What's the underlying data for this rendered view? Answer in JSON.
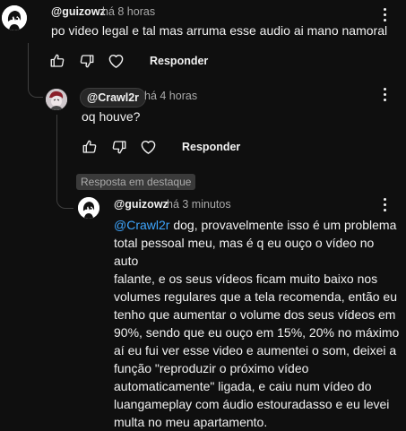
{
  "comments": [
    {
      "author": "@guizowz",
      "time": "há 8 horas",
      "text": "po video legal e tal mas arruma esse audio ai mano namoral",
      "reply_label": "Responder"
    },
    {
      "author": "@Crawl2r",
      "time": "há 4 horas",
      "text": "oq houve?",
      "reply_label": "Responder"
    },
    {
      "badge": "Resposta em destaque",
      "author": "@guizowz",
      "time": "há 3 minutos",
      "mention": "@Crawl2r",
      "lines": [
        " dog, provavelmente isso é um problema",
        "total pessoal meu, mas é q eu ouço o vídeo no auto",
        "falante, e os seus vídeos ficam muito baixo nos",
        "volumes regulares que a tela recomenda, então eu",
        "tenho que aumentar o volume dos seus vídeos em",
        "90%, sendo que eu ouço em 15%, 20% no máximo",
        "aí eu fui ver esse video e aumentei o som, deixei a",
        "função \"reproduzir o próximo vídeo",
        "automaticamente\" ligada, e caiu num vídeo do",
        "luangameplay com áudio estouradasso e eu levei",
        "multa no meu apartamento."
      ]
    }
  ]
}
